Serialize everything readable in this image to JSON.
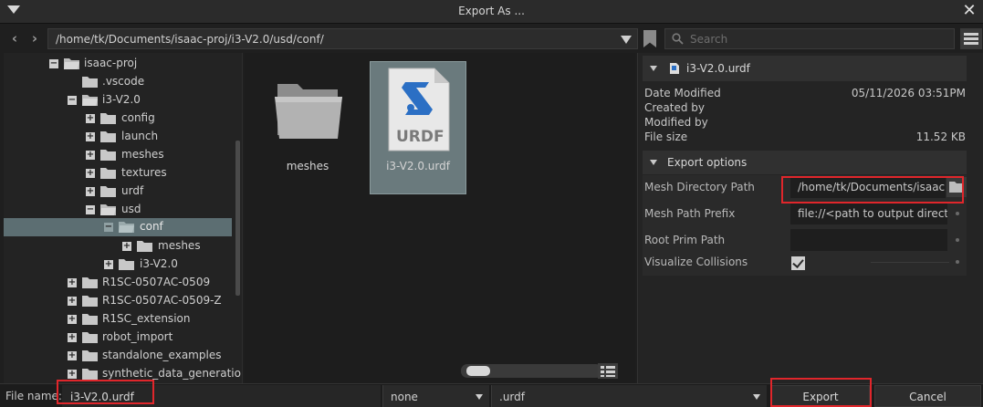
{
  "window": {
    "title": "Export As ..."
  },
  "nav": {
    "back_icon": "chevron-left-icon",
    "forward_icon": "chevron-right-icon",
    "path": "/home/tk/Documents/isaac-proj/i3-V2.0/usd/conf/",
    "search_placeholder": "Search"
  },
  "tree": {
    "items": [
      {
        "label": "isaac-proj",
        "expander": "−",
        "open": true
      },
      {
        "label": ".vscode",
        "expander": "",
        "open": false
      },
      {
        "label": "i3-V2.0",
        "expander": "−",
        "open": true
      },
      {
        "label": "config",
        "expander": "+",
        "open": false
      },
      {
        "label": "launch",
        "expander": "+",
        "open": false
      },
      {
        "label": "meshes",
        "expander": "+",
        "open": false
      },
      {
        "label": "textures",
        "expander": "+",
        "open": false
      },
      {
        "label": "urdf",
        "expander": "+",
        "open": false
      },
      {
        "label": "usd",
        "expander": "−",
        "open": true
      },
      {
        "label": "conf",
        "expander": "−",
        "open": true,
        "selected": true
      },
      {
        "label": "meshes",
        "expander": "+",
        "open": false
      },
      {
        "label": "i3-V2.0",
        "expander": "+",
        "open": false
      },
      {
        "label": "R1SC-0507AC-0509",
        "expander": "+",
        "open": false
      },
      {
        "label": "R1SC-0507AC-0509-Z",
        "expander": "+",
        "open": false
      },
      {
        "label": "R1SC_extension",
        "expander": "+",
        "open": false
      },
      {
        "label": "robot_import",
        "expander": "+",
        "open": false
      },
      {
        "label": "standalone_examples",
        "expander": "+",
        "open": false
      },
      {
        "label": "synthetic_data_generatio",
        "expander": "+",
        "open": false
      }
    ]
  },
  "grid": {
    "items": [
      {
        "label": "meshes",
        "icon": "folder-icon"
      },
      {
        "label": "i3-V2.0.urdf",
        "icon": "urdf-file-icon",
        "icon_text": "URDF",
        "selected": true
      }
    ]
  },
  "detail": {
    "file_name": "i3-V2.0.urdf",
    "info": [
      {
        "key": "Date Modified",
        "value": "05/11/2026 03:51PM"
      },
      {
        "key": "Created by",
        "value": ""
      },
      {
        "key": "Modified by",
        "value": ""
      },
      {
        "key": "File size",
        "value": "11.52 KB"
      }
    ],
    "export_options_title": "Export options",
    "options": {
      "mesh_dir_label": "Mesh Directory Path",
      "mesh_dir_value": "/home/tk/Documents/isaac",
      "mesh_prefix_label": "Mesh Path Prefix",
      "mesh_prefix_value": "file://<path to output directo",
      "root_prim_label": "Root Prim Path",
      "root_prim_value": "",
      "visualize_label": "Visualize Collisions",
      "visualize_checked": true
    }
  },
  "bottom": {
    "file_name_label": "File name:",
    "file_name_value": "i3-V2.0.urdf",
    "filter_value": "none",
    "extension_value": ".urdf",
    "export_label": "Export",
    "cancel_label": "Cancel"
  },
  "colors": {
    "highlight": "#e0262b",
    "selection": "#5c6e72"
  }
}
